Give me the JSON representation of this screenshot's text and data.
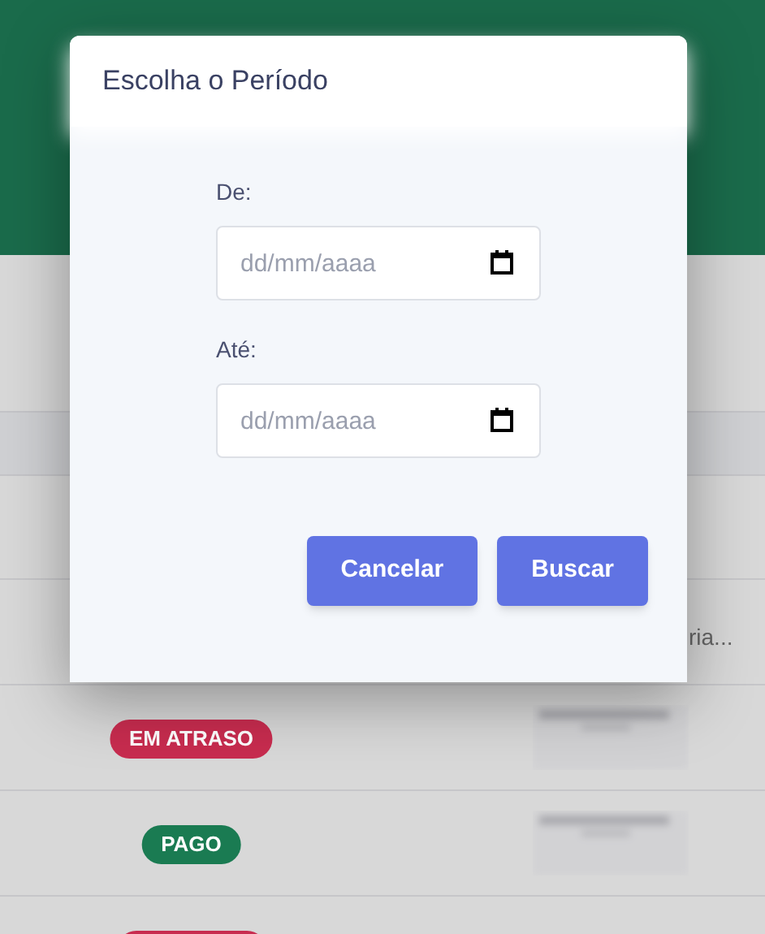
{
  "modal": {
    "title": "Escolha o Período",
    "fields": [
      {
        "label": "De:",
        "placeholder": "dd/mm/aaaa"
      },
      {
        "label": "Até:",
        "placeholder": "dd/mm/aaaa"
      }
    ],
    "buttons": [
      "Cancelar",
      "Buscar"
    ]
  },
  "table": {
    "rows": [
      {
        "column_2": "ria..."
      },
      {
        "status": {
          "text": "EM ATRASO",
          "kind": "overdue"
        }
      },
      {
        "status": {
          "text": "PAGO",
          "kind": "paid"
        }
      },
      {
        "status": {
          "kind": "overdue"
        }
      }
    ]
  }
}
